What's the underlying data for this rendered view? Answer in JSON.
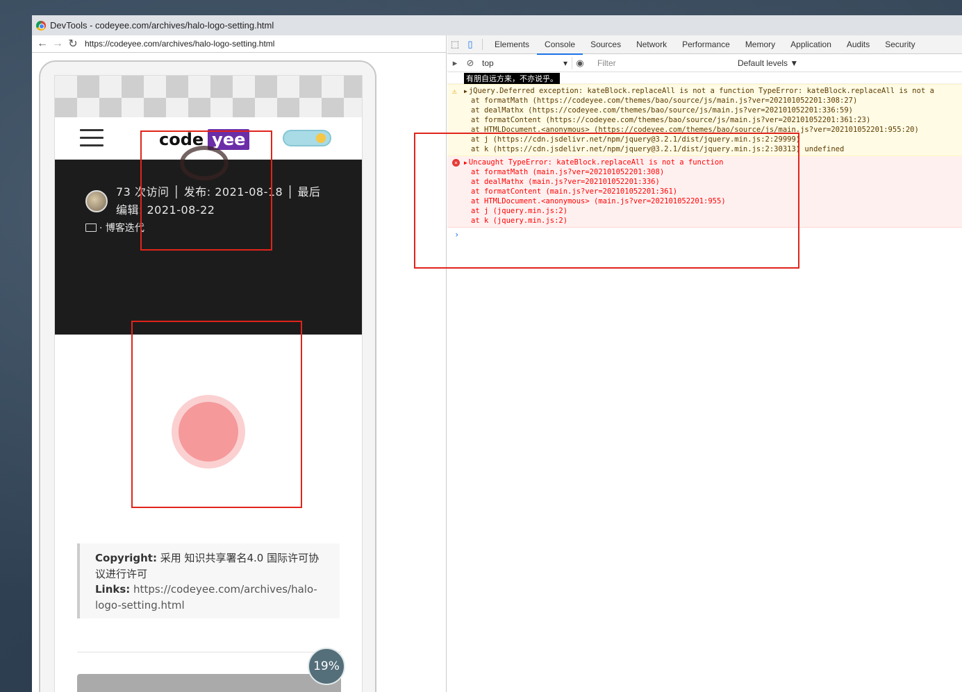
{
  "window": {
    "title": "DevTools - codeyee.com/archives/halo-logo-setting.html"
  },
  "url": "https://codeyee.com/archives/halo-logo-setting.html",
  "site": {
    "logo_code": "code",
    "logo_yee": "yee",
    "meta_line1": "73 次访问 │ 发布: 2021-08-18 │ 最后",
    "meta_line2": "编辑: 2021-08-22",
    "category": "· 博客迭代",
    "copyright_label": "Copyright:",
    "copyright_text": " 采用 知识共享署名4.0 国际许可协议进行许可",
    "links_label": "Links:",
    "links_url": " https://codeyee.com/archives/halo-logo-setting.html",
    "progress": "19%"
  },
  "devtools": {
    "tabs": [
      "Elements",
      "Console",
      "Sources",
      "Network",
      "Performance",
      "Memory",
      "Application",
      "Audits",
      "Security"
    ],
    "active_tab": "Console",
    "context": "top",
    "filter_placeholder": "Filter",
    "levels": "Default levels ▼",
    "highlight_text": "有朋自远方来，不亦说乎。",
    "warning_lines": [
      "jQuery.Deferred exception: kateBlock.replaceAll is not a function TypeError: kateBlock.replaceAll is not a",
      "at formatMath (https://codeyee.com/themes/bao/source/js/main.js?ver=202101052201:308:27)",
      "at dealMathx (https://codeyee.com/themes/bao/source/js/main.js?ver=202101052201:336:59)",
      "at formatContent (https://codeyee.com/themes/bao/source/js/main.js?ver=202101052201:361:23)",
      "at HTMLDocument.<anonymous> (https://codeyee.com/themes/bao/source/js/main.js?ver=202101052201:955:20)",
      "at j (https://cdn.jsdelivr.net/npm/jquery@3.2.1/dist/jquery.min.js:2:29999)",
      "at k (https://cdn.jsdelivr.net/npm/jquery@3.2.1/dist/jquery.min.js:2:30313) undefined"
    ],
    "error_lines": [
      "Uncaught TypeError: kateBlock.replaceAll is not a function",
      "at formatMath (main.js?ver=202101052201:308)",
      "at dealMathx (main.js?ver=202101052201:336)",
      "at formatContent (main.js?ver=202101052201:361)",
      "at HTMLDocument.<anonymous> (main.js?ver=202101052201:955)",
      "at j (jquery.min.js:2)",
      "at k (jquery.min.js:2)"
    ],
    "prompt": "›"
  },
  "colors": {
    "error": "#ff0000",
    "warning_bg": "#fffbe5",
    "annotation": "#e0241b",
    "logo_bg": "#6b2ea8"
  }
}
